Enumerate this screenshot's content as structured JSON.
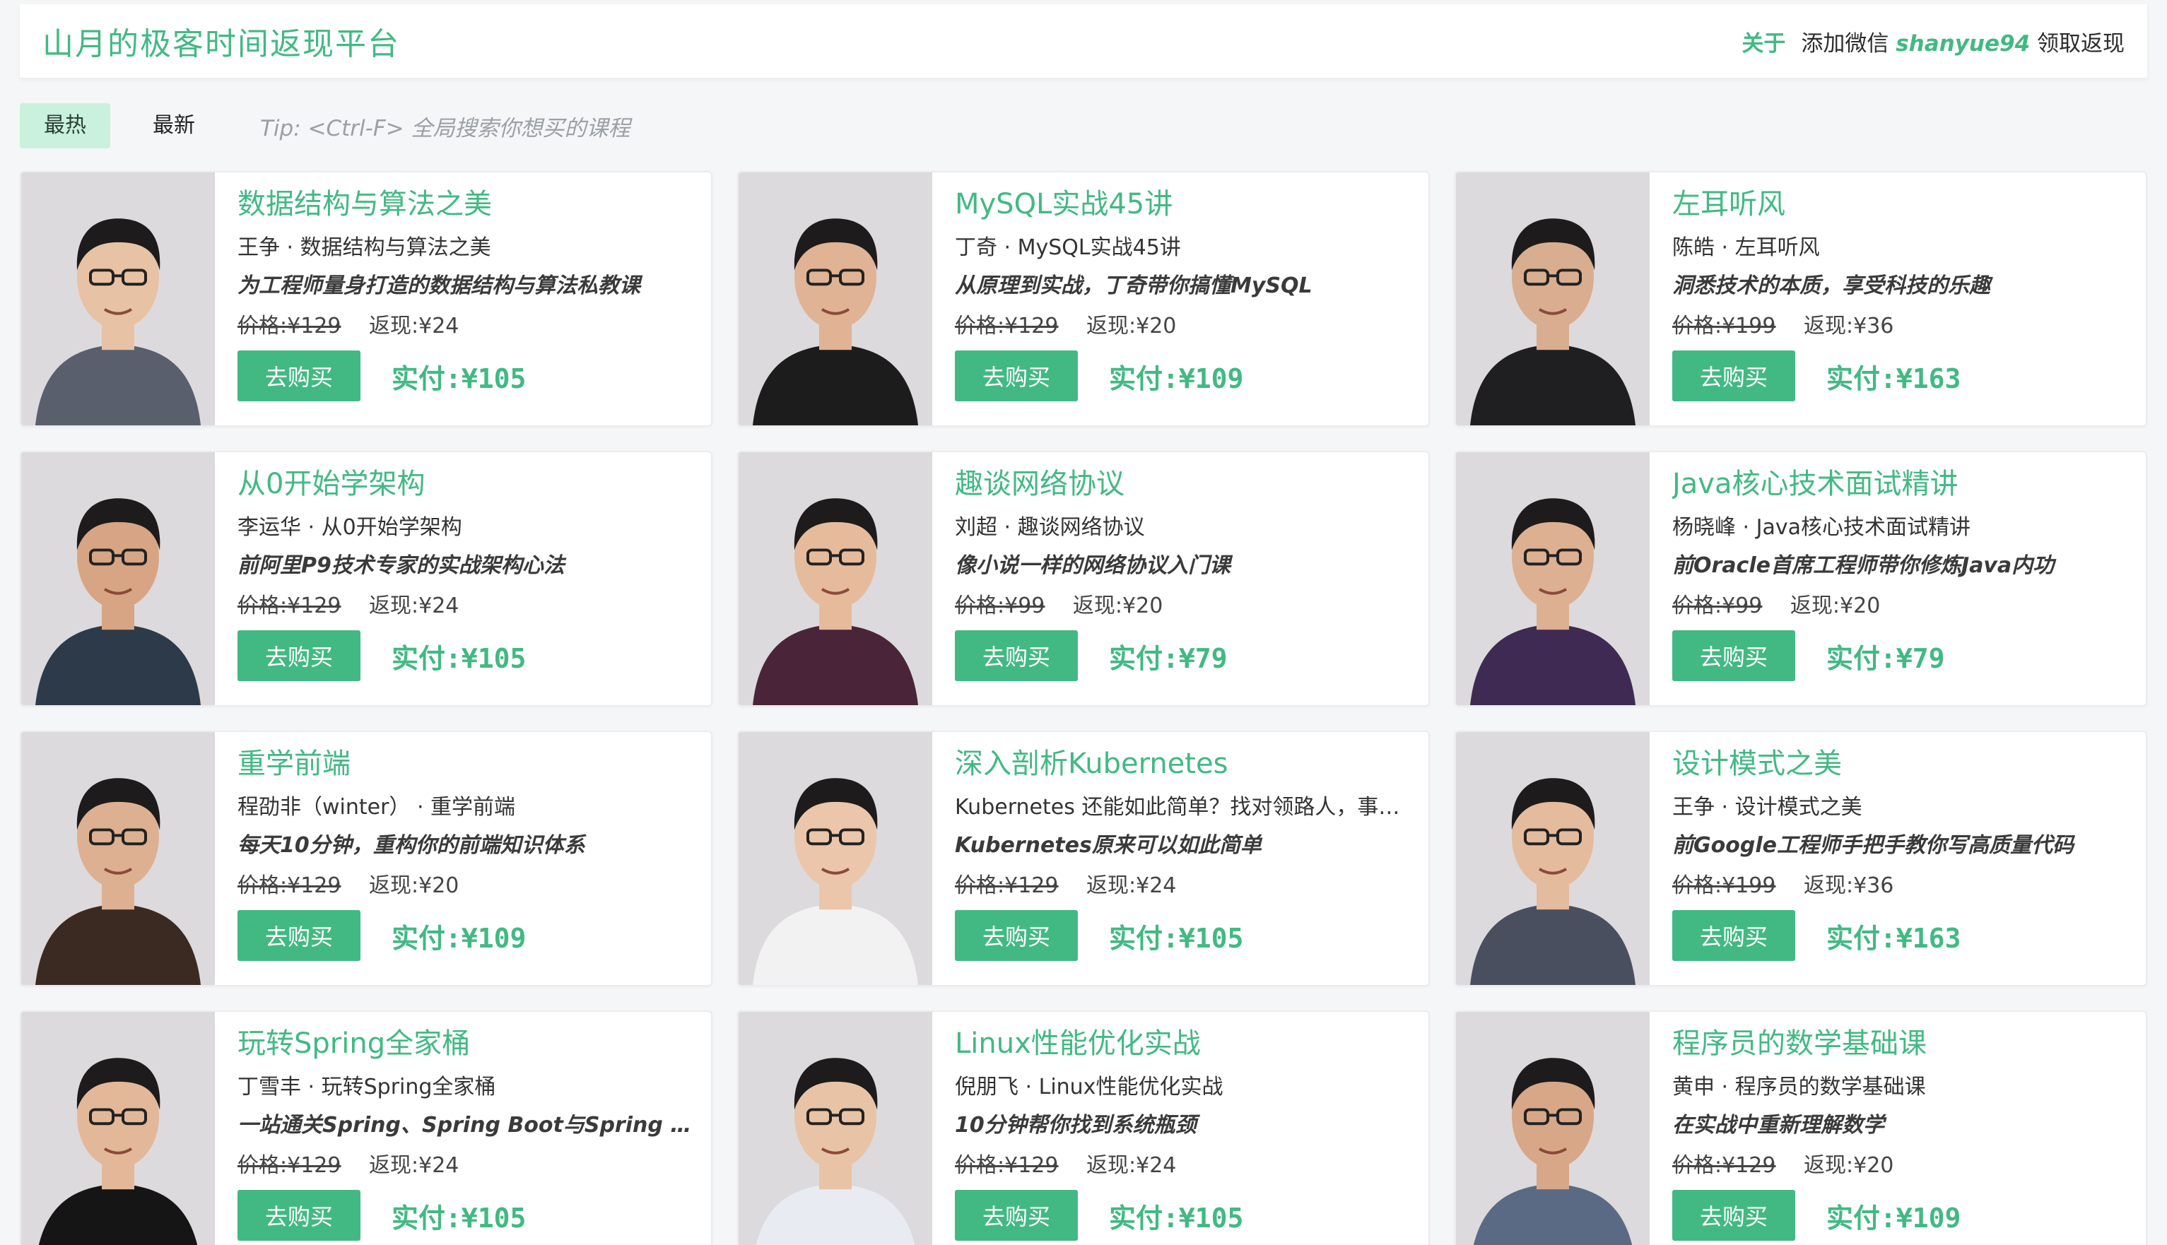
{
  "header": {
    "brand": "山月的极客时间返现平台",
    "about_label": "关于",
    "wechat_prefix": "添加微信",
    "wechat_id": "shanyue94",
    "wechat_suffix": "领取返现"
  },
  "toolbar": {
    "tabs": [
      {
        "label": "最热",
        "active": true
      },
      {
        "label": "最新",
        "active": false
      }
    ],
    "tip": "Tip: <Ctrl-F> 全局搜索你想买的课程"
  },
  "colors": {
    "accent": "#42b983",
    "active_tab_bg": "#c9f1dd"
  },
  "courses": [
    {
      "title": "数据结构与算法之美",
      "author": "王争 · 数据结构与算法之美",
      "slogan": "为工程师量身打造的数据结构与算法私教课",
      "price": "价格:¥129",
      "rebate": "返现:¥24",
      "buy_label": "去购买",
      "pay": "实付:¥105",
      "shirt": "#5a5f6e",
      "skin": "#e8c2a4"
    },
    {
      "title": "MySQL实战45讲",
      "author": "丁奇 · MySQL实战45讲",
      "slogan": "从原理到实战，丁奇带你搞懂MySQL",
      "price": "价格:¥129",
      "rebate": "返现:¥20",
      "buy_label": "去购买",
      "pay": "实付:¥109",
      "shirt": "#1c1c1c",
      "skin": "#e0b394"
    },
    {
      "title": "左耳听风",
      "author": "陈皓 · 左耳听风",
      "slogan": "洞悉技术的本质，享受科技的乐趣",
      "price": "价格:¥199",
      "rebate": "返现:¥36",
      "buy_label": "去购买",
      "pay": "实付:¥163",
      "shirt": "#1f1f22",
      "skin": "#d9ad90"
    },
    {
      "title": "从0开始学架构",
      "author": "李运华 · 从0开始学架构",
      "slogan": "前阿里P9技术专家的实战架构心法",
      "price": "价格:¥129",
      "rebate": "返现:¥24",
      "buy_label": "去购买",
      "pay": "实付:¥105",
      "shirt": "#2d3a4a",
      "skin": "#d7a583"
    },
    {
      "title": "趣谈网络协议",
      "author": "刘超 · 趣谈网络协议",
      "slogan": "像小说一样的网络协议入门课",
      "price": "价格:¥99",
      "rebate": "返现:¥20",
      "buy_label": "去购买",
      "pay": "实付:¥79",
      "shirt": "#4a2438",
      "skin": "#e6bb9c"
    },
    {
      "title": "Java核心技术面试精讲",
      "author": "杨晓峰 · Java核心技术面试精讲",
      "slogan": "前Oracle首席工程师带你修炼Java内功",
      "price": "价格:¥99",
      "rebate": "返现:¥20",
      "buy_label": "去购买",
      "pay": "实付:¥79",
      "shirt": "#3e2a52",
      "skin": "#ddb091"
    },
    {
      "title": "重学前端",
      "author": "程劭非（winter） · 重学前端",
      "slogan": "每天10分钟，重构你的前端知识体系",
      "price": "价格:¥129",
      "rebate": "返现:¥20",
      "buy_label": "去购买",
      "pay": "实付:¥109",
      "shirt": "#3b2a22",
      "skin": "#ddb092"
    },
    {
      "title": "深入剖析Kubernetes",
      "author": "Kubernetes 还能如此简单？找对领路人，事…",
      "slogan": "Kubernetes原来可以如此简单",
      "price": "价格:¥129",
      "rebate": "返现:¥24",
      "buy_label": "去购买",
      "pay": "实付:¥105",
      "shirt": "#f2f2f2",
      "skin": "#ebc6aa"
    },
    {
      "title": "设计模式之美",
      "author": "王争 · 设计模式之美",
      "slogan": "前Google工程师手把手教你写高质量代码",
      "price": "价格:¥199",
      "rebate": "返现:¥36",
      "buy_label": "去购买",
      "pay": "实付:¥163",
      "shirt": "#4a4f60",
      "skin": "#e4bb9d"
    },
    {
      "title": "玩转Spring全家桶",
      "author": "丁雪丰 · 玩转Spring全家桶",
      "slogan": "一站通关Spring、Spring Boot与Spring Clo…",
      "price": "价格:¥129",
      "rebate": "返现:¥24",
      "buy_label": "去购买",
      "pay": "实付:¥105",
      "shirt": "#151515",
      "skin": "#e3b899"
    },
    {
      "title": "Linux性能优化实战",
      "author": "倪朋飞 · Linux性能优化实战",
      "slogan": "10分钟帮你找到系统瓶颈",
      "price": "价格:¥129",
      "rebate": "返现:¥24",
      "buy_label": "去购买",
      "pay": "实付:¥105",
      "shirt": "#e8ecf2",
      "skin": "#e9c3a5"
    },
    {
      "title": "程序员的数学基础课",
      "author": "黄申 · 程序员的数学基础课",
      "slogan": "在实战中重新理解数学",
      "price": "价格:¥129",
      "rebate": "返现:¥20",
      "buy_label": "去购买",
      "pay": "实付:¥109",
      "shirt": "#5b6a84",
      "skin": "#d8a787"
    }
  ]
}
